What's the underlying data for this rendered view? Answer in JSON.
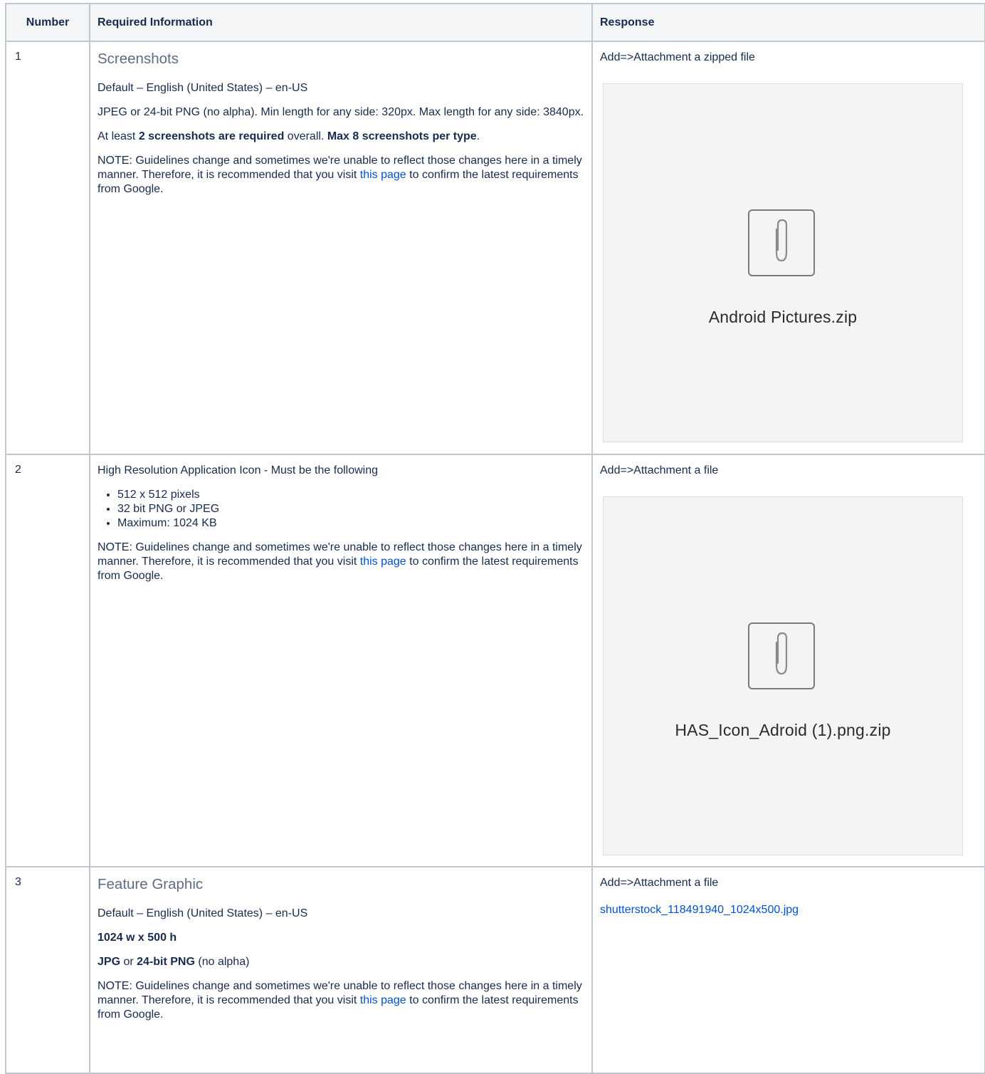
{
  "headers": {
    "number": "Number",
    "required": "Required Information",
    "response": "Response"
  },
  "rows": [
    {
      "number": "1",
      "heading": "Screenshots",
      "default_locale": "Default – English (United States) – en-US",
      "format": "JPEG or 24-bit PNG (no alpha). Min length for any side: 320px. Max length for any side: 3840px.",
      "atleast_prefix": "At least ",
      "atleast_bold": "2 screenshots are required",
      "atleast_mid": " overall. ",
      "max_bold": "Max 8 screenshots per type",
      "max_suffix": ".",
      "note_pre": "NOTE:  Guidelines change and sometimes we're unable to reflect those changes here in a timely manner.  Therefore, it is recommended that you visit ",
      "note_link": "this page",
      "note_post": " to confirm the latest requirements from Google.",
      "response_label": "Add=>Attachment a zipped file",
      "attachment_name": "Android Pictures.zip"
    },
    {
      "number": "2",
      "intro": "High Resolution Application Icon - Must be the following",
      "bullets": [
        "512 x 512 pixels",
        "32 bit PNG or JPEG",
        "Maximum: 1024 KB"
      ],
      "note_pre": "NOTE:  Guidelines change and sometimes we're unable to reflect those changes here in a timely manner.  Therefore, it is recommended that you visit ",
      "note_link": "this page",
      "note_post": " to confirm the latest requirements from Google.",
      "response_label": "Add=>Attachment a file",
      "attachment_name": "HAS_Icon_Adroid (1).png.zip"
    },
    {
      "number": "3",
      "heading": "Feature Graphic",
      "default_locale": "Default – English (United States) – en-US",
      "size_bold": "1024 w x 500 h",
      "fmt_bold1": "JPG",
      "fmt_mid": " or ",
      "fmt_bold2": "24-bit PNG",
      "fmt_suffix": " (no alpha)",
      "note_pre": "NOTE:  Guidelines change and sometimes we're unable to reflect those changes here in a timely manner.  Therefore, it is recommended that you visit ",
      "note_link": "this page",
      "note_post": " to confirm the latest requirements from Google.",
      "response_label": "Add=>Attachment a file",
      "response_link": "shutterstock_118491940_1024x500.jpg"
    }
  ]
}
